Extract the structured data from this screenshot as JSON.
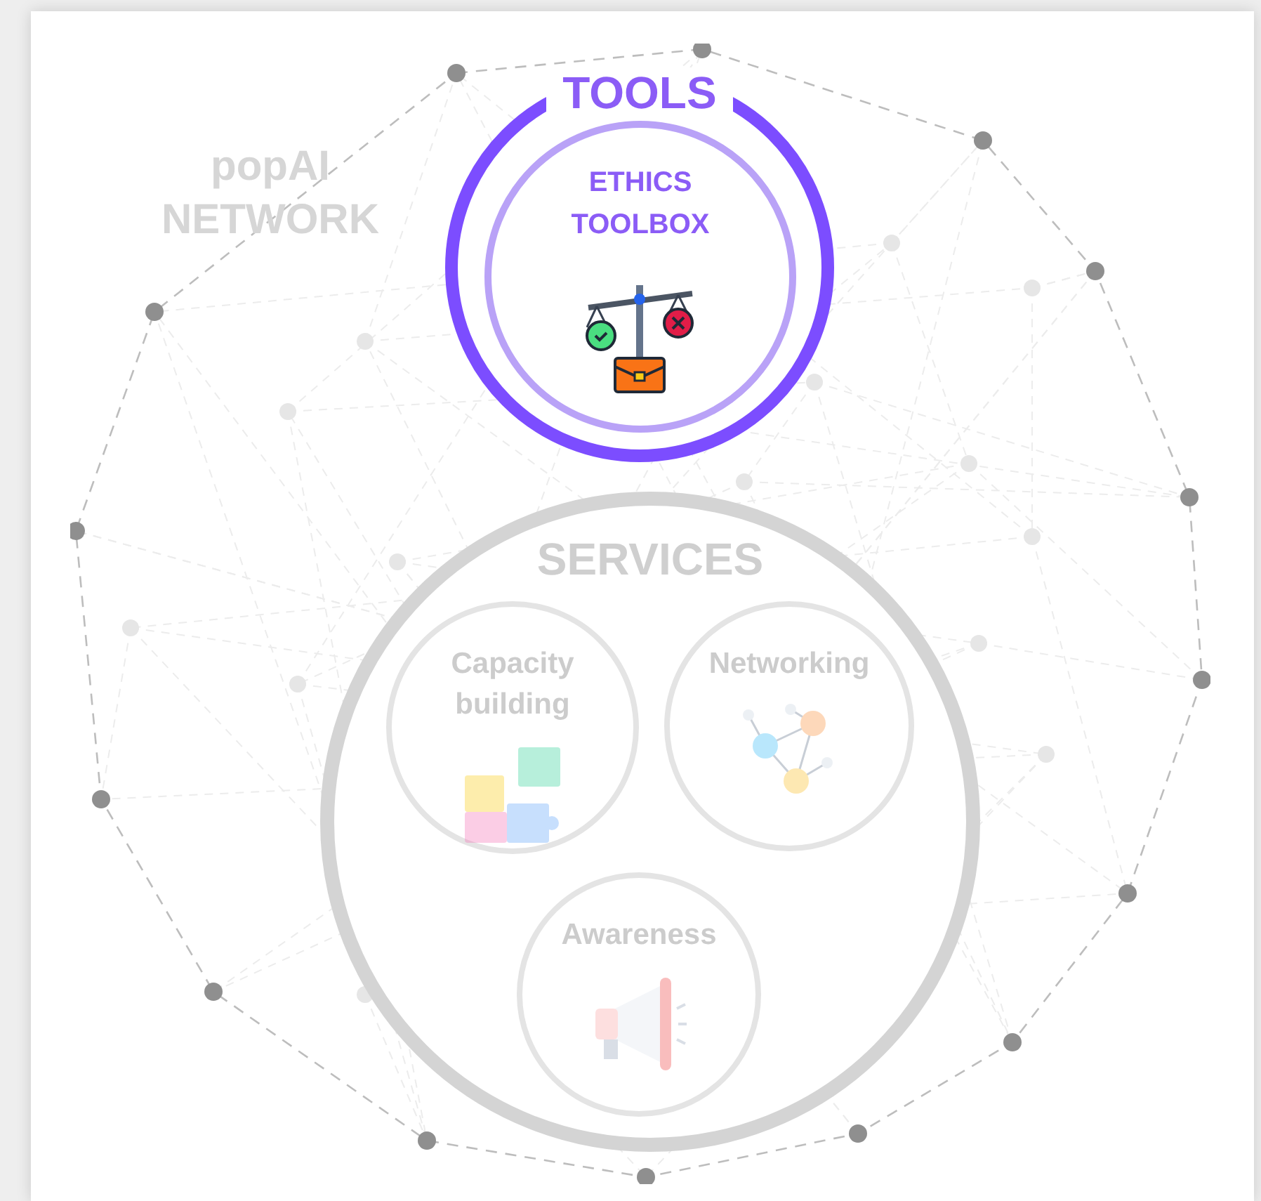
{
  "network_label": "popAI\nNETWORK",
  "sections": [
    {
      "title": "TOOLS",
      "highlighted": true,
      "items": [
        {
          "kind": "scale",
          "label": "ETHICS\nTOOLBOX"
        }
      ]
    },
    {
      "title": "SERVICES",
      "highlighted": false,
      "items": [
        {
          "kind": "puzzle",
          "label": "Capacity\nbuilding"
        },
        {
          "kind": "network",
          "label": "Networking"
        },
        {
          "kind": "megaphone",
          "label": "Awareness"
        }
      ]
    }
  ]
}
